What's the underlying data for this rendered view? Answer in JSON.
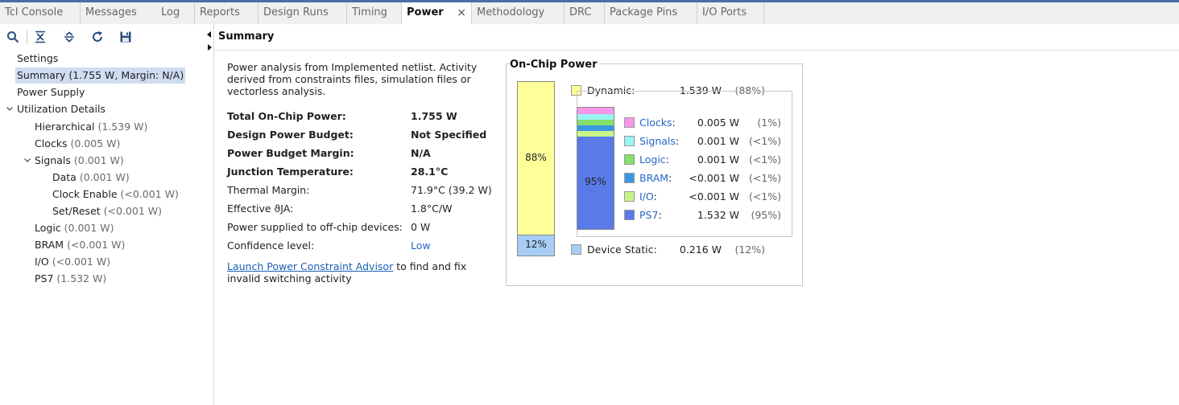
{
  "tabs": [
    {
      "label": "Tcl Console",
      "active": false
    },
    {
      "label": "Messages",
      "active": false
    },
    {
      "label": "Log",
      "active": false
    },
    {
      "label": "Reports",
      "active": false
    },
    {
      "label": "Design Runs",
      "active": false
    },
    {
      "label": "Timing",
      "active": false
    },
    {
      "label": "Power",
      "active": true
    },
    {
      "label": "Methodology",
      "active": false
    },
    {
      "label": "DRC",
      "active": false
    },
    {
      "label": "Package Pins",
      "active": false
    },
    {
      "label": "I/O Ports",
      "active": false
    }
  ],
  "tab_close_glyph": "×",
  "toolbar": {
    "icons": [
      "search-icon",
      "collapse-all-icon",
      "expand-all-icon",
      "refresh-icon",
      "save-icon"
    ]
  },
  "tree": {
    "settings": {
      "label": "Settings",
      "value": ""
    },
    "summary": {
      "label": "Summary (1.755 W, Margin: N/A)",
      "value": ""
    },
    "power_supply": {
      "label": "Power Supply",
      "value": ""
    },
    "utilization": {
      "label": "Utilization Details",
      "value": ""
    },
    "hierarchical": {
      "label": "Hierarchical",
      "value": "(1.539 W)"
    },
    "clocks": {
      "label": "Clocks",
      "value": "(0.005 W)"
    },
    "signals": {
      "label": "Signals",
      "value": "(0.001 W)"
    },
    "data": {
      "label": "Data",
      "value": "(0.001 W)"
    },
    "clock_enable": {
      "label": "Clock Enable",
      "value": "(<0.001 W)"
    },
    "set_reset": {
      "label": "Set/Reset",
      "value": "(<0.001 W)"
    },
    "logic": {
      "label": "Logic",
      "value": "(0.001 W)"
    },
    "bram": {
      "label": "BRAM",
      "value": "(<0.001 W)"
    },
    "io": {
      "label": "I/O",
      "value": "(<0.001 W)"
    },
    "ps7": {
      "label": "PS7",
      "value": "(1.532 W)"
    }
  },
  "summary": {
    "title": "Summary",
    "description": "Power analysis from Implemented netlist. Activity derived from constraints files, simulation files or vectorless analysis.",
    "rows": {
      "total": {
        "label": "Total On-Chip Power:",
        "value": "1.755 W"
      },
      "budget": {
        "label": "Design Power Budget:",
        "value": "Not Specified"
      },
      "margin": {
        "label": "Power Budget Margin:",
        "value": "N/A"
      },
      "junction": {
        "label": "Junction Temperature:",
        "value": "28.1°C"
      },
      "thermal": {
        "label": "Thermal Margin:",
        "value": "71.9°C (39.2 W)"
      },
      "theta": {
        "label": "Effective ϑJA:",
        "value": "1.8°C/W"
      },
      "offchip": {
        "label": "Power supplied to off-chip devices:",
        "value": "0 W"
      },
      "confidence": {
        "label": "Confidence level:",
        "value": "Low"
      }
    },
    "advisor_link": "Launch Power Constraint Advisor",
    "advisor_text": " to find and fix invalid switching activity"
  },
  "onchip": {
    "title": "On-Chip Power",
    "dynamic": {
      "label": "Dynamic:",
      "value": "1.539 W",
      "pct": "(88%)",
      "bar_label": "88%",
      "fraction": 0.88,
      "color": "#ffff99"
    },
    "static": {
      "label": "Device Static:",
      "value": "0.216 W",
      "pct": "(12%)",
      "bar_label": "12%",
      "fraction": 0.12,
      "color": "#a6cdf5"
    },
    "breakdown": {
      "clocks": {
        "label": "Clocks",
        "value": "0.005 W",
        "pct": "(1%)",
        "color": "#f598ec"
      },
      "signals": {
        "label": "Signals",
        "value": "0.001 W",
        "pct": "(<1%)",
        "color": "#99f5f2"
      },
      "logic": {
        "label": "Logic",
        "value": "0.001 W",
        "pct": "(<1%)",
        "color": "#83e06b"
      },
      "bram": {
        "label": "BRAM",
        "value": "<0.001 W",
        "pct": "(<1%)",
        "color": "#3a96e0"
      },
      "io": {
        "label": "I/O",
        "value": "<0.001 W",
        "pct": "(<1%)",
        "color": "#c8f58a"
      },
      "ps7": {
        "label": "PS7",
        "value": "1.532 W",
        "pct": "(95%)",
        "color": "#5a7ae8"
      }
    },
    "ps7_bar_label": "95%",
    "colon": ":"
  }
}
